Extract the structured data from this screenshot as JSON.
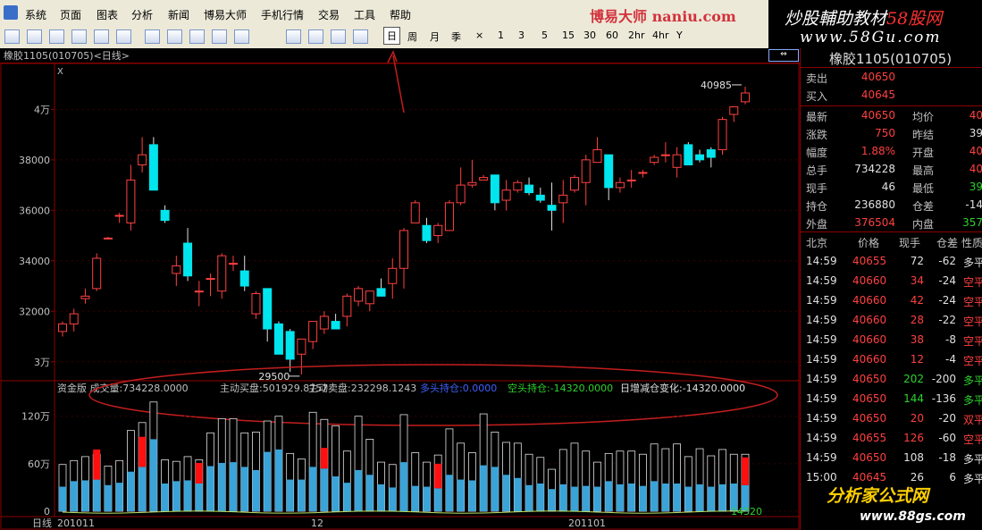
{
  "menubar": {
    "items": [
      "系统",
      "页面",
      "图表",
      "分析",
      "新闻",
      "博易大师",
      "手机行情",
      "交易",
      "工具",
      "帮助"
    ],
    "watermark": "博易大师 naniu.com"
  },
  "toolbar": {
    "periods": [
      "日",
      "周",
      "月",
      "季",
      "×",
      "1",
      "3",
      "5",
      "15",
      "30",
      "60",
      "2hr",
      "4hr",
      "Y"
    ],
    "selected_period": "日"
  },
  "brand": {
    "line1_main": "炒股輔助教材",
    "line1_accent": "58股网",
    "line2": "www.58Gu.com"
  },
  "chart": {
    "title": "橡胶1105(010705)<日线>",
    "corner": "X",
    "price_axis": [
      "4万",
      "38000",
      "36000",
      "34000",
      "32000",
      "3万"
    ],
    "high_label": "40985",
    "low_label": "29500",
    "indicator_header": [
      {
        "text": "资金版 成交量:734228.0000",
        "color": "#c0c0c0"
      },
      {
        "text": "主动买盘:501929.8757",
        "color": "#c0c0c0"
      },
      {
        "text": "主动卖盘:232298.1243",
        "color": "#c0c0c0"
      },
      {
        "text": "多头持仓:0.0000",
        "color": "#4060ff"
      },
      {
        "text": "空头持仓:-14320.0000",
        "color": "#2dd22d"
      },
      {
        "text": "日增减仓变化:-14320.0000",
        "color": "#e0e0e0"
      }
    ],
    "volume_axis": [
      "120万",
      "60万",
      "0"
    ],
    "volume_end_label": "14320",
    "date_axis": [
      "日线",
      "201011",
      "12",
      "201101"
    ]
  },
  "chart_data": {
    "type": "candlestick",
    "title": "橡胶1105(010705)<日线>",
    "price_range": [
      29000,
      41500
    ],
    "candles": [
      [
        31200,
        31600,
        31000,
        31500
      ],
      [
        31500,
        32100,
        31200,
        31900
      ],
      [
        32500,
        32900,
        32300,
        32600
      ],
      [
        32900,
        34300,
        32800,
        34100
      ],
      [
        34900,
        34950,
        34850,
        34900
      ],
      [
        35800,
        35900,
        35500,
        35800
      ],
      [
        35500,
        37800,
        35200,
        37200
      ],
      [
        37800,
        38900,
        37500,
        38200
      ],
      [
        38600,
        38900,
        37000,
        36800
      ],
      [
        36000,
        36200,
        35500,
        35600
      ],
      [
        33500,
        34200,
        33000,
        33800
      ],
      [
        34700,
        35300,
        33200,
        33400
      ],
      [
        32800,
        33200,
        32200,
        32800
      ],
      [
        33300,
        33500,
        32600,
        33300
      ],
      [
        32800,
        34300,
        32500,
        34200
      ],
      [
        33900,
        34200,
        33600,
        33900
      ],
      [
        33600,
        34200,
        32800,
        33000
      ],
      [
        31900,
        32800,
        31700,
        32700
      ],
      [
        32900,
        32900,
        30800,
        31300
      ],
      [
        31500,
        31600,
        30300,
        30300
      ],
      [
        31200,
        31300,
        29600,
        30100
      ],
      [
        30300,
        30900,
        29500,
        30900
      ],
      [
        30800,
        31600,
        30500,
        31600
      ],
      [
        31300,
        32000,
        31100,
        31800
      ],
      [
        31600,
        31900,
        31300,
        31300
      ],
      [
        31800,
        32700,
        31400,
        32600
      ],
      [
        32400,
        33000,
        32200,
        32900
      ],
      [
        32300,
        32700,
        32000,
        32800
      ],
      [
        32900,
        33300,
        32600,
        32600
      ],
      [
        33100,
        34100,
        32500,
        33700
      ],
      [
        33700,
        35300,
        32900,
        35200
      ],
      [
        35500,
        36400,
        35500,
        36300
      ],
      [
        35400,
        35700,
        34700,
        34800
      ],
      [
        35000,
        35500,
        34700,
        35400
      ],
      [
        35200,
        36400,
        35200,
        36300
      ],
      [
        36300,
        37700,
        36200,
        37000
      ],
      [
        37000,
        38000,
        36900,
        37100
      ],
      [
        37200,
        37400,
        37300,
        37300
      ],
      [
        37400,
        37200,
        36000,
        36300
      ],
      [
        36400,
        37200,
        36000,
        36800
      ],
      [
        36800,
        37200,
        36700,
        37100
      ],
      [
        37000,
        37300,
        36600,
        36700
      ],
      [
        36600,
        36900,
        36300,
        36400
      ],
      [
        36200,
        37100,
        35200,
        36000
      ],
      [
        36300,
        37200,
        35500,
        36600
      ],
      [
        36800,
        37400,
        36700,
        37300
      ],
      [
        37100,
        38200,
        36200,
        38000
      ],
      [
        37900,
        38900,
        37900,
        38400
      ],
      [
        38200,
        38100,
        36400,
        36900
      ],
      [
        36900,
        37300,
        36700,
        37100
      ],
      [
        37200,
        37600,
        36900,
        37200
      ],
      [
        37500,
        37600,
        37300,
        37500
      ],
      [
        37900,
        38200,
        37800,
        38100
      ],
      [
        38200,
        38700,
        37900,
        38200
      ],
      [
        37700,
        38500,
        37300,
        38200
      ],
      [
        38600,
        38700,
        37900,
        37800
      ],
      [
        38200,
        38400,
        37900,
        38000
      ],
      [
        38400,
        38500,
        37700,
        38100
      ],
      [
        38400,
        39700,
        38200,
        39600
      ],
      [
        39800,
        40100,
        39500,
        40100
      ],
      [
        40300,
        40900,
        40200,
        40650
      ]
    ],
    "volume_axis_max": 1400000,
    "volume_total": [
      590000,
      640000,
      690000,
      720000,
      570000,
      640000,
      1020000,
      1120000,
      1380000,
      650000,
      630000,
      690000,
      650000,
      990000,
      1170000,
      1170000,
      990000,
      1000000,
      1140000,
      1200000,
      730000,
      660000,
      1250000,
      1160000,
      1080000,
      760000,
      1200000,
      910000,
      620000,
      590000,
      1220000,
      740000,
      620000,
      710000,
      1040000,
      860000,
      740000,
      1230000,
      1000000,
      870000,
      860000,
      720000,
      680000,
      530000,
      780000,
      860000,
      760000,
      620000,
      730000,
      760000,
      760000,
      720000,
      850000,
      790000,
      850000,
      690000,
      790000,
      700000,
      780000,
      720000,
      720000
    ],
    "volume_active_buy": [
      310000,
      380000,
      390000,
      400000,
      330000,
      360000,
      500000,
      560000,
      910000,
      350000,
      380000,
      390000,
      350000,
      570000,
      610000,
      620000,
      560000,
      520000,
      750000,
      780000,
      400000,
      400000,
      560000,
      540000,
      440000,
      360000,
      520000,
      460000,
      340000,
      300000,
      620000,
      320000,
      310000,
      290000,
      460000,
      400000,
      390000,
      580000,
      560000,
      460000,
      420000,
      330000,
      350000,
      280000,
      340000,
      310000,
      320000,
      310000,
      380000,
      340000,
      350000,
      320000,
      380000,
      350000,
      350000,
      310000,
      340000,
      310000,
      340000,
      350000,
      330000
    ],
    "volume_active_sell": [
      0,
      0,
      0,
      380000,
      0,
      0,
      0,
      380000,
      0,
      0,
      0,
      0,
      260000,
      0,
      0,
      0,
      0,
      0,
      0,
      0,
      0,
      0,
      0,
      260000,
      0,
      0,
      0,
      0,
      0,
      0,
      0,
      0,
      0,
      310000,
      0,
      0,
      0,
      0,
      0,
      0,
      0,
      0,
      0,
      0,
      0,
      0,
      0,
      0,
      0,
      0,
      0,
      0,
      0,
      0,
      0,
      0,
      0,
      0,
      0,
      0,
      350000
    ],
    "ylim": [
      29000,
      41500
    ],
    "xlabel_ticks": [
      "201011",
      "12",
      "201101"
    ]
  },
  "quote": {
    "symbol": "橡胶1105(010705)",
    "sell": {
      "label": "卖出",
      "value": "40650"
    },
    "buy": {
      "label": "买入",
      "value": "40645"
    },
    "stats": [
      {
        "l1": "最新",
        "v1": "40650",
        "c1": "#ff4040",
        "l2": "均价",
        "v2": "40",
        "c2": "#ff4040"
      },
      {
        "l1": "涨跌",
        "v1": "750",
        "c1": "#ff4040",
        "l2": "昨结",
        "v2": "39",
        "c2": "#e0e0e0"
      },
      {
        "l1": "幅度",
        "v1": "1.88%",
        "c1": "#ff4040",
        "l2": "开盘",
        "v2": "40",
        "c2": "#ff4040"
      },
      {
        "l1": "总手",
        "v1": "734228",
        "c1": "#e0e0e0",
        "l2": "最高",
        "v2": "40",
        "c2": "#ff4040"
      },
      {
        "l1": "现手",
        "v1": "46",
        "c1": "#e0e0e0",
        "l2": "最低",
        "v2": "39",
        "c2": "#2dd22d"
      },
      {
        "l1": "持仓",
        "v1": "236880",
        "c1": "#e0e0e0",
        "l2": "仓差",
        "v2": "-14",
        "c2": "#e0e0e0"
      },
      {
        "l1": "外盘",
        "v1": "376504",
        "c1": "#ff4040",
        "l2": "内盘",
        "v2": "357",
        "c2": "#2dd22d"
      }
    ],
    "ticks_header": [
      "北京",
      "价格",
      "现手",
      "仓差",
      "性质"
    ],
    "ticks": [
      {
        "time": "14:59",
        "price": "40655",
        "vol": "72",
        "diff": "-62",
        "type": "多平",
        "vc": "#e0e0e0",
        "tc": "#e0e0e0"
      },
      {
        "time": "14:59",
        "price": "40660",
        "vol": "34",
        "diff": "-24",
        "type": "空平",
        "vc": "#ff4040",
        "tc": "#ff4040"
      },
      {
        "time": "14:59",
        "price": "40660",
        "vol": "42",
        "diff": "-24",
        "type": "空平",
        "vc": "#ff4040",
        "tc": "#ff4040"
      },
      {
        "time": "14:59",
        "price": "40660",
        "vol": "28",
        "diff": "-22",
        "type": "空平",
        "vc": "#ff4040",
        "tc": "#ff4040"
      },
      {
        "time": "14:59",
        "price": "40660",
        "vol": "38",
        "diff": "-8",
        "type": "空平",
        "vc": "#ff4040",
        "tc": "#ff4040"
      },
      {
        "time": "14:59",
        "price": "40660",
        "vol": "12",
        "diff": "-4",
        "type": "空平",
        "vc": "#ff4040",
        "tc": "#ff4040"
      },
      {
        "time": "14:59",
        "price": "40650",
        "vol": "202",
        "diff": "-200",
        "type": "多平",
        "vc": "#2dd22d",
        "tc": "#2dd22d"
      },
      {
        "time": "14:59",
        "price": "40650",
        "vol": "144",
        "diff": "-136",
        "type": "多平",
        "vc": "#2dd22d",
        "tc": "#2dd22d"
      },
      {
        "time": "14:59",
        "price": "40650",
        "vol": "20",
        "diff": "-20",
        "type": "双平",
        "vc": "#ff4040",
        "tc": "#ff4040"
      },
      {
        "time": "14:59",
        "price": "40655",
        "vol": "126",
        "diff": "-60",
        "type": "空平",
        "vc": "#ff4040",
        "tc": "#ff4040"
      },
      {
        "time": "14:59",
        "price": "40650",
        "vol": "108",
        "diff": "-18",
        "type": "多平",
        "vc": "#e0e0e0",
        "tc": "#e0e0e0"
      },
      {
        "time": "15:00",
        "price": "40645",
        "vol": "26",
        "diff": "6",
        "type": "多平",
        "vc": "#e0e0e0",
        "tc": "#e0e0e0"
      }
    ]
  },
  "logo": {
    "text": "分析家公式网",
    "url": "www.88gs.com"
  },
  "colors": {
    "up": "#ff4040",
    "down": "#00e5ee",
    "volume_blue": "#3aa3d8",
    "volume_red": "#ff1010",
    "grid": "#8b0000",
    "annotation": "#c41e1e"
  }
}
